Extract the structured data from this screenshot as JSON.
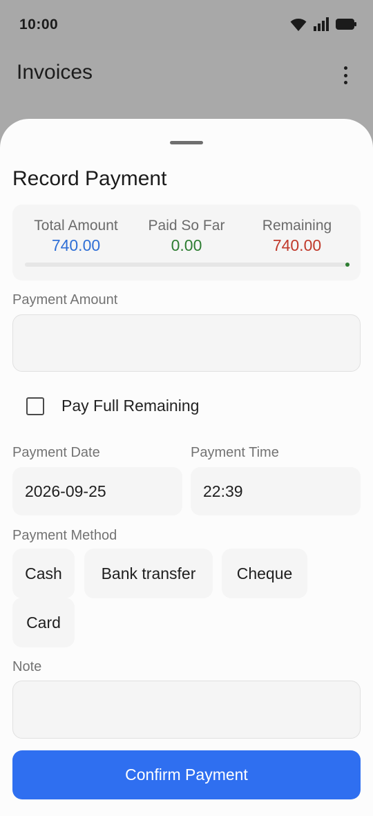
{
  "status_bar": {
    "time": "10:00",
    "icons": [
      "wifi-icon",
      "signal-icon",
      "battery-icon"
    ]
  },
  "app_bar": {
    "title": "Invoices",
    "menu_icon": "more-vert-icon"
  },
  "sheet": {
    "title": "Record Payment",
    "summary": {
      "total_label": "Total Amount",
      "total_value": "740.00",
      "paid_label": "Paid So Far",
      "paid_value": "0.00",
      "remaining_label": "Remaining",
      "remaining_value": "740.00",
      "paid_fraction": 0.0
    },
    "payment_amount": {
      "label": "Payment Amount",
      "value": ""
    },
    "pay_full_remaining": {
      "label": "Pay Full Remaining",
      "checked": false
    },
    "payment_date": {
      "label": "Payment Date",
      "value": "2026-09-25"
    },
    "payment_time": {
      "label": "Payment Time",
      "value": "22:39"
    },
    "payment_method": {
      "label": "Payment Method",
      "options": [
        "Cash",
        "Bank transfer",
        "Cheque",
        "Card"
      ]
    },
    "note": {
      "label": "Note",
      "value": ""
    },
    "confirm_label": "Confirm Payment"
  },
  "colors": {
    "accent": "#2f6ff0",
    "total_value": "#2f6fd6",
    "paid_value": "#2e7d32",
    "remaining_value": "#c0392b",
    "scrim": "#a9a9a9"
  }
}
